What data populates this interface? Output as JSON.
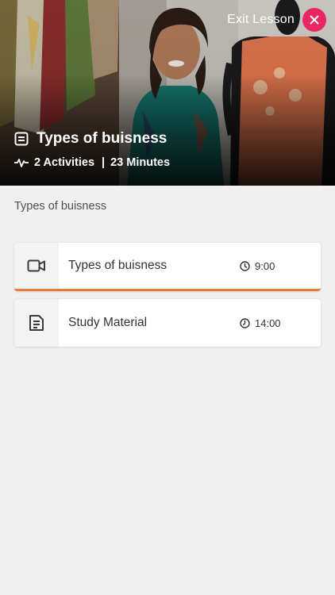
{
  "header": {
    "exit_label": "Exit Lesson",
    "lesson_title": "Types of buisness",
    "activities": "2 Activities",
    "duration": "23 Minutes",
    "separator": "|"
  },
  "main": {
    "section_title": "Types of buisness",
    "activities": [
      {
        "title": "Types of buisness",
        "duration": "9:00",
        "icon": "video-camera-icon",
        "active": true
      },
      {
        "title": "Study Material",
        "duration": "14:00",
        "icon": "document-icon",
        "active": false
      }
    ]
  },
  "colors": {
    "accent": "#e8793f",
    "exit_button": "#ea2564",
    "background": "#f0f0f0"
  }
}
